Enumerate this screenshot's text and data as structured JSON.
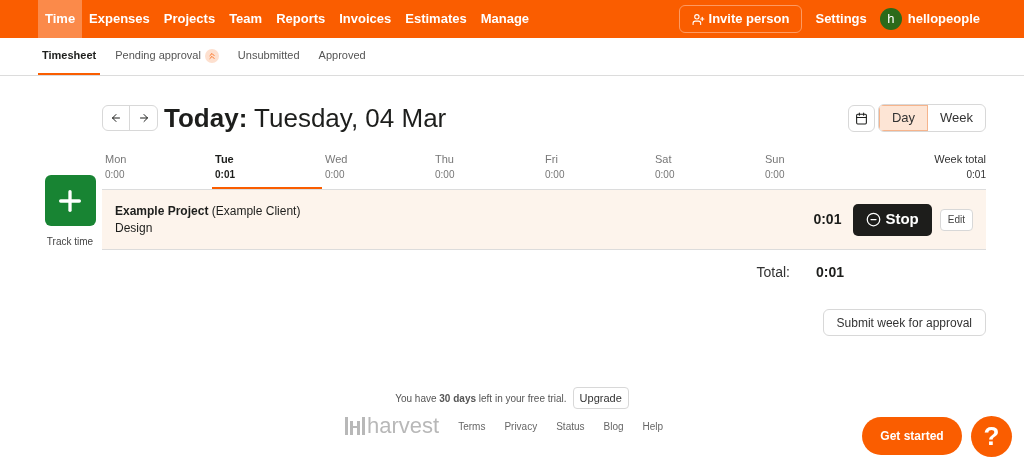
{
  "nav": {
    "items": [
      {
        "label": "Time",
        "selected": true
      },
      {
        "label": "Expenses",
        "selected": false
      },
      {
        "label": "Projects",
        "selected": false
      },
      {
        "label": "Team",
        "selected": false
      },
      {
        "label": "Reports",
        "selected": false
      },
      {
        "label": "Invoices",
        "selected": false
      },
      {
        "label": "Estimates",
        "selected": false
      },
      {
        "label": "Manage",
        "selected": false
      }
    ],
    "invite": "Invite person",
    "settings": "Settings",
    "user": {
      "initial": "h",
      "name": "hellopeople"
    }
  },
  "subtabs": [
    {
      "label": "Timesheet",
      "selected": true,
      "badge": false
    },
    {
      "label": "Pending approval",
      "selected": false,
      "badge": true
    },
    {
      "label": "Unsubmitted",
      "selected": false,
      "badge": false
    },
    {
      "label": "Approved",
      "selected": false,
      "badge": false
    }
  ],
  "title": {
    "prefix": "Today:",
    "date": "Tuesday, 04 Mar"
  },
  "view": [
    {
      "label": "Day",
      "selected": true
    },
    {
      "label": "Week",
      "selected": false
    }
  ],
  "track_time": "Track time",
  "days": [
    {
      "name": "Mon",
      "time": "0:00",
      "selected": false
    },
    {
      "name": "Tue",
      "time": "0:01",
      "selected": true
    },
    {
      "name": "Wed",
      "time": "0:00",
      "selected": false
    },
    {
      "name": "Thu",
      "time": "0:00",
      "selected": false
    },
    {
      "name": "Fri",
      "time": "0:00",
      "selected": false
    },
    {
      "name": "Sat",
      "time": "0:00",
      "selected": false
    },
    {
      "name": "Sun",
      "time": "0:00",
      "selected": false
    }
  ],
  "week_total": {
    "label": "Week total",
    "time": "0:01"
  },
  "entries": [
    {
      "project": "**Example Project** (Example Client)",
      "task": "Design",
      "time": "0:01",
      "running": true,
      "stop": "Stop",
      "edit": "Edit"
    }
  ],
  "total": {
    "label": "Total:",
    "time": "0:01"
  },
  "submit": "Submit week for approval",
  "trial": {
    "text": "You have **30 days** left in your free trial.",
    "button": "Upgrade"
  },
  "footer": {
    "logo": "harvest",
    "links": [
      "Terms",
      "Privacy",
      "Status",
      "Blog",
      "Help"
    ]
  },
  "get_started": "Get started",
  "help": "?"
}
